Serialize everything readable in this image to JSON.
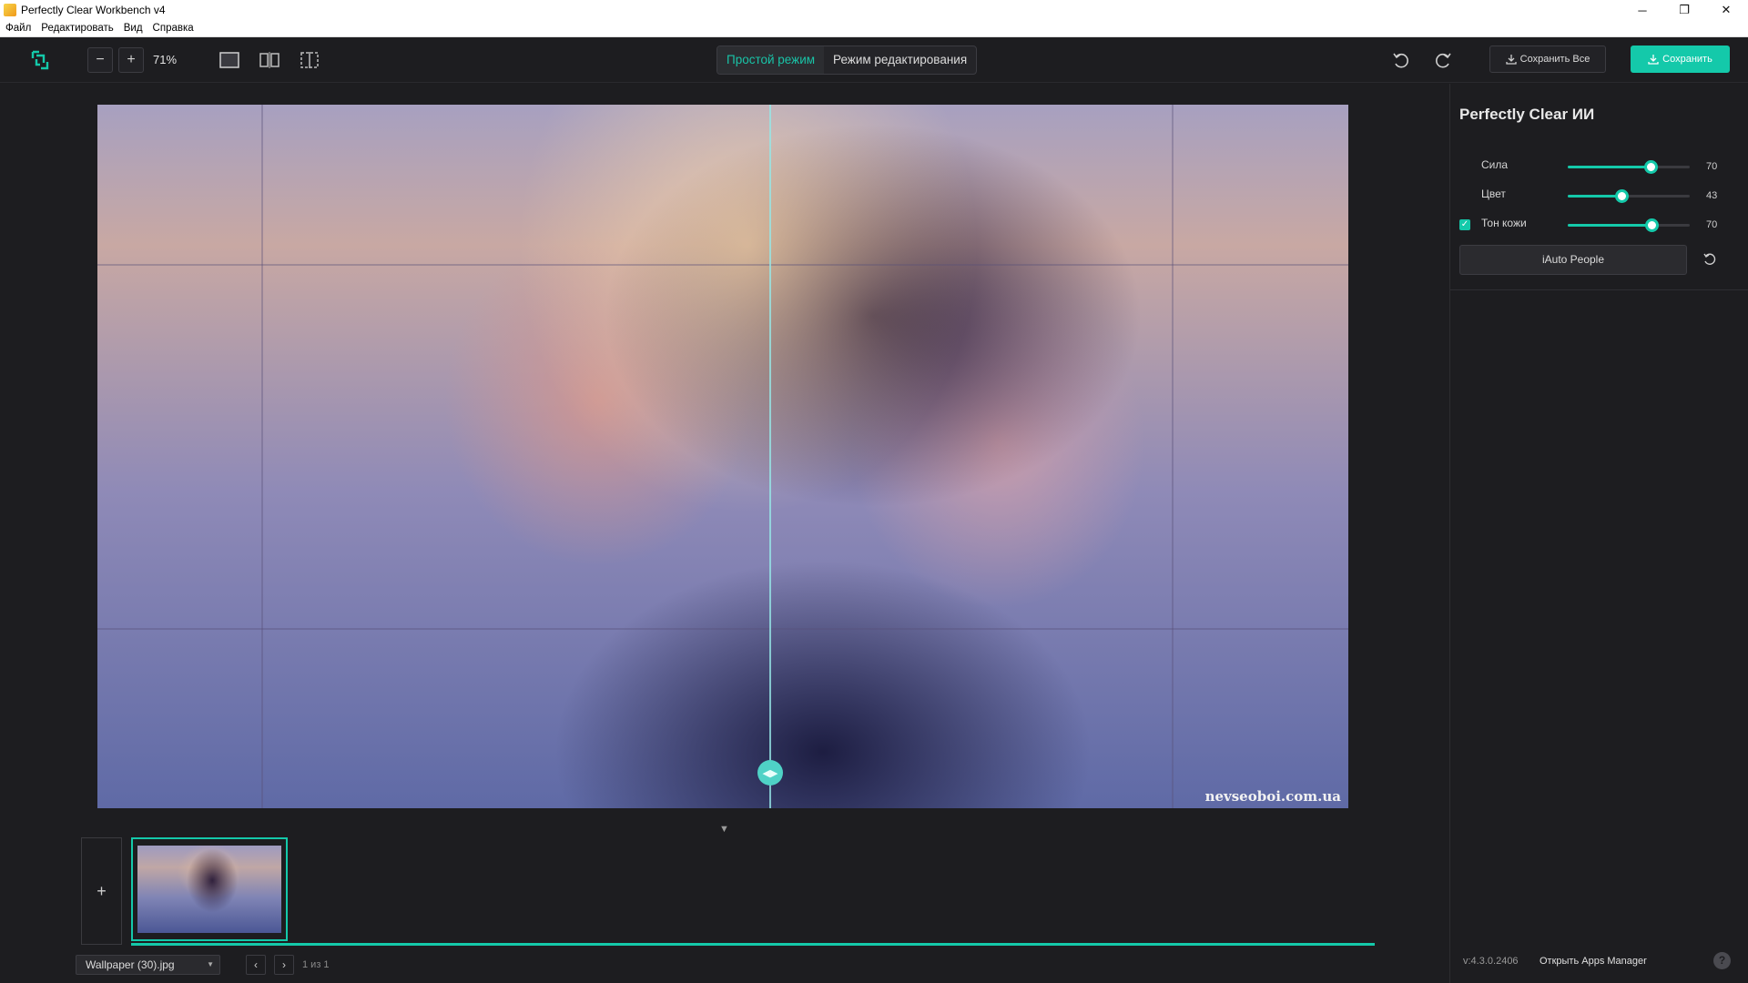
{
  "window": {
    "title": "Perfectly Clear Workbench v4",
    "controls": {
      "minimize": "─",
      "maximize": "❐",
      "close": "✕"
    }
  },
  "menu": [
    "Файл",
    "Редактировать",
    "Вид",
    "Справка"
  ],
  "toolbar": {
    "zoom_out": "−",
    "zoom_in": "+",
    "zoom_level": "71%",
    "mode_simple": "Простой режим",
    "mode_edit": "Режим редактирования",
    "save_all": "Сохранить Все",
    "save": "Сохранить",
    "accent": "#14c9aa"
  },
  "canvas": {
    "watermark": "nevseoboi.com.ua",
    "split_handle": "◀▶",
    "collapse": "▼"
  },
  "filmstrip": {
    "add": "+",
    "file_name": "Wallpaper (30).jpg",
    "prev": "‹",
    "next": "›",
    "page": "1 из 1"
  },
  "panel": {
    "title": "Perfectly Clear ИИ",
    "sliders": [
      {
        "label": "Сила",
        "value": "70",
        "fraction": 0.68
      },
      {
        "label": "Цвет",
        "value": "43",
        "fraction": 0.44
      },
      {
        "label": "Тон кожи",
        "value": "70",
        "fraction": 0.69,
        "checked": true
      }
    ],
    "check_mark": "✓",
    "preset_button": "iAuto People",
    "version": "v:4.3.0.2406",
    "apps_manager": "Открыть Apps Manager",
    "help": "?"
  }
}
